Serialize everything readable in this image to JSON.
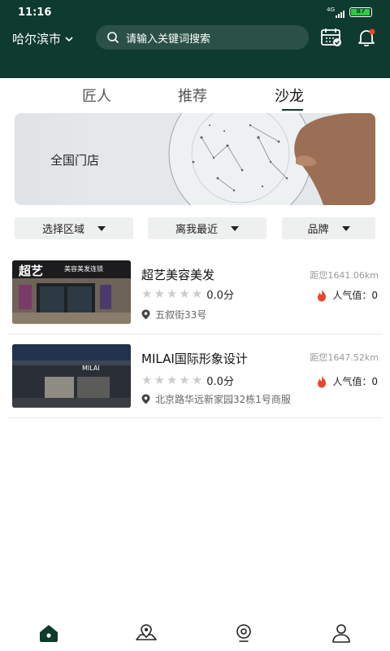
{
  "status_bar": {
    "time": "11:16",
    "network": "4G",
    "battery": "87"
  },
  "header": {
    "city": "哈尔滨市",
    "search_placeholder": "请输入关键词搜索",
    "icons": [
      "calendar-check-icon",
      "bell-icon"
    ],
    "accent_color": "#0f3a2e"
  },
  "tabs": [
    {
      "label": "匠人",
      "active": false
    },
    {
      "label": "推荐",
      "active": false
    },
    {
      "label": "沙龙",
      "active": true
    }
  ],
  "banner": {
    "text": "全国门店"
  },
  "filters": [
    {
      "label": "选择区域"
    },
    {
      "label": "离我最近"
    },
    {
      "label": "品牌"
    }
  ],
  "shops": [
    {
      "name": "超艺美容美发",
      "distance": "距您1641.06km",
      "score": "0.0分",
      "popularity": "人气值：0",
      "address": "五叙街33号",
      "sign_text": "超艺",
      "sign_sub": "美容美发连锁"
    },
    {
      "name": "MILAI国际形象设计",
      "distance": "距您1647.52km",
      "score": "0.0分",
      "popularity": "人气值：0",
      "address": "北京路华远新家园32栋1号商服",
      "sign_text": "MILAI"
    }
  ],
  "bottom_tabs": [
    "home-icon",
    "map-pin-icon",
    "discover-icon",
    "profile-icon"
  ]
}
